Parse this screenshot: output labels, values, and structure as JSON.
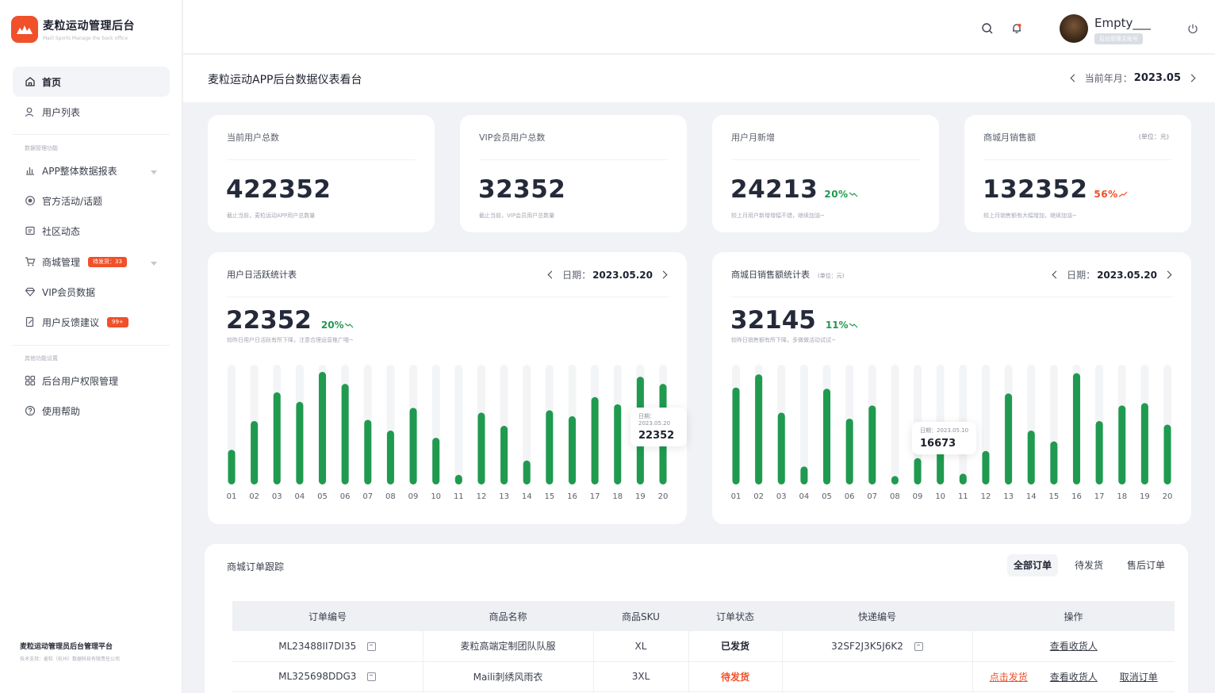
{
  "brand": {
    "title": "麦粒运动管理后台",
    "subtitle": "Maili Sports Manage the back office"
  },
  "sidebar": {
    "items": [
      {
        "label": "首页",
        "icon": "home-icon"
      },
      {
        "label": "用户列表",
        "icon": "user-icon"
      },
      {
        "label": "APP整体数据报表",
        "icon": "bar-chart-icon"
      },
      {
        "label": "官方活动/话题",
        "icon": "activity-icon"
      },
      {
        "label": "社区动态",
        "icon": "community-icon"
      },
      {
        "label": "商城管理",
        "icon": "cart-icon",
        "badge": "待发货：33"
      },
      {
        "label": "VIP会员数据",
        "icon": "diamond-icon"
      },
      {
        "label": "用户反馈建议",
        "icon": "feedback-icon",
        "badge": "99+"
      },
      {
        "label": "后台用户权限管理",
        "icon": "grid-icon"
      },
      {
        "label": "使用帮助",
        "icon": "help-icon"
      }
    ],
    "section1": "数据管理功能",
    "section2": "其他功能设置",
    "footer_title": "麦粒运动管理员后台管理平台",
    "footer_sub": "技术支持：麦粒（杭州）数据科技有限责任公司"
  },
  "header": {
    "user_name": "Empty___",
    "user_role": "后台管理主账号"
  },
  "page": {
    "title": "麦粒运动APP后台数据仪表看台",
    "month_label": "当前年月：",
    "month_value": "2023.05"
  },
  "stats": [
    {
      "label": "当前用户总数",
      "value": "422352",
      "desc": "截止当前，麦粒运动APP用户总数量"
    },
    {
      "label": "VIP会员用户总数",
      "value": "32352",
      "desc": "截止当前，VIP会员用户总数量"
    },
    {
      "label": "用户月新增",
      "value": "24213",
      "change": "20%",
      "trend": "down",
      "desc": "较上月用户新增增幅不错，继续加油~"
    },
    {
      "label": "商城月销售额",
      "unit": "(单位：元)",
      "value": "132352",
      "change": "56%",
      "trend": "up",
      "desc": "较上月销售额有大幅增加，继续加油~"
    }
  ],
  "colors": {
    "accent": "#f0502a",
    "bar": "#1f9a4f",
    "bar_track": "#f3f4f6"
  },
  "charts": {
    "dau": {
      "title": "用户日活跃统计表",
      "date_label": "日期：",
      "date_value": "2023.05.20",
      "big": "22352",
      "change": "20%",
      "desc": "较昨日用户日活跃有所下降，注意合理运营推广哦~",
      "tooltip_label": "日期：2023.05.20",
      "tooltip_value": "22352"
    },
    "sales": {
      "title": "商城日销售额统计表",
      "unit": "(单位：元)",
      "date_label": "日期：",
      "date_value": "2023.05.20",
      "big": "32145",
      "change": "11%",
      "desc": "较昨日销售额有所下降，多做做活动试试~",
      "tooltip_label": "日期：2023.05.10",
      "tooltip_value": "16673"
    }
  },
  "chart_data": [
    {
      "type": "bar",
      "categories": [
        "01",
        "02",
        "03",
        "04",
        "05",
        "06",
        "07",
        "08",
        "09",
        "10",
        "11",
        "12",
        "13",
        "14",
        "15",
        "16",
        "17",
        "18",
        "19",
        "20"
      ],
      "values": [
        29,
        53,
        77,
        69,
        94,
        84,
        54,
        45,
        64,
        39,
        8,
        60,
        49,
        20,
        62,
        57,
        73,
        67,
        90,
        84
      ],
      "ylim": [
        0,
        100
      ]
    },
    {
      "type": "bar",
      "categories": [
        "01",
        "02",
        "03",
        "04",
        "05",
        "06",
        "07",
        "08",
        "09",
        "10",
        "11",
        "12",
        "13",
        "14",
        "15",
        "16",
        "17",
        "18",
        "19",
        "20"
      ],
      "values": [
        81,
        92,
        60,
        15,
        80,
        55,
        66,
        7,
        22,
        40,
        9,
        28,
        76,
        45,
        36,
        93,
        53,
        66,
        68,
        50
      ],
      "ylim": [
        0,
        100
      ]
    }
  ],
  "orders": {
    "title": "商城订单跟踪",
    "tabs": [
      "全部订单",
      "待发货",
      "售后订单"
    ],
    "columns": [
      "订单编号",
      "商品名称",
      "商品SKU",
      "订单状态",
      "快递编号",
      "操作"
    ],
    "rows": [
      {
        "id": "ML23488II7DI35",
        "name": "麦粒高端定制团队队服",
        "sku": "XL",
        "status": "已发货",
        "express": "32SF2J3K5J6K2",
        "actions": [
          "查看收货人"
        ]
      },
      {
        "id": "ML325698DDG3",
        "name": "Maili刺绣风雨衣",
        "sku": "3XL",
        "status": "待发货",
        "express": "",
        "actions": [
          "点击发货",
          "查看收货人",
          "取消订单"
        ]
      }
    ]
  }
}
